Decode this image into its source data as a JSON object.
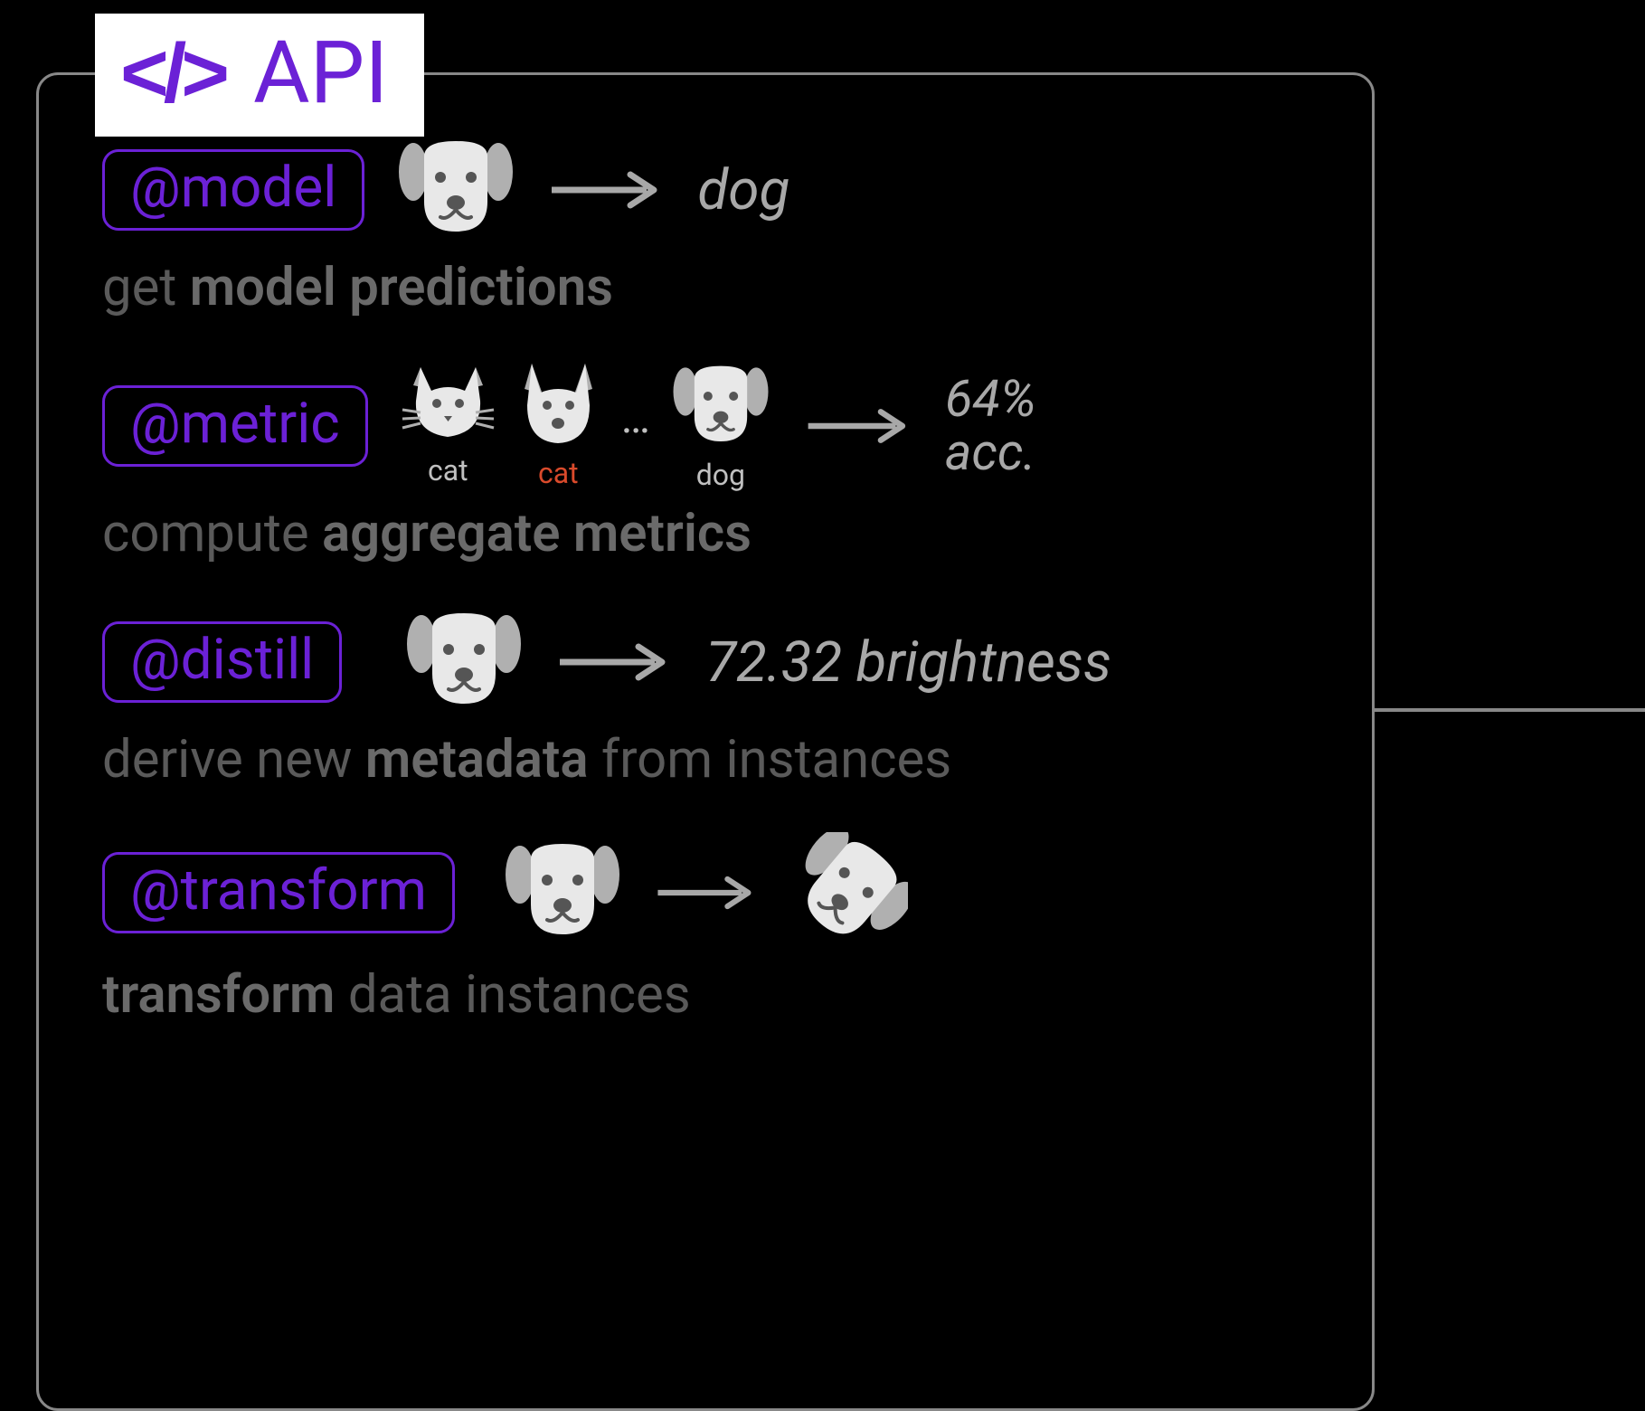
{
  "title": "API",
  "code_icon": "</>",
  "rows": {
    "model": {
      "decorator": "@model",
      "output": "dog",
      "desc_plain1": "get ",
      "desc_bold": "model predictions",
      "desc_plain2": ""
    },
    "metric": {
      "decorator": "@metric",
      "samples": {
        "cat": "cat",
        "cat_error": "cat",
        "dog": "dog"
      },
      "ellipsis": "…",
      "output_line1": "64%",
      "output_line2": "acc.",
      "desc_plain1": "compute ",
      "desc_bold": "aggregate metrics",
      "desc_plain2": ""
    },
    "distill": {
      "decorator": "@distill",
      "output": "72.32 brightness",
      "desc_plain1": "derive new ",
      "desc_bold": "metadata",
      "desc_plain2": " from instances"
    },
    "transform": {
      "decorator": "@transform",
      "desc_bold": "transform",
      "desc_plain2": " data instances"
    }
  }
}
